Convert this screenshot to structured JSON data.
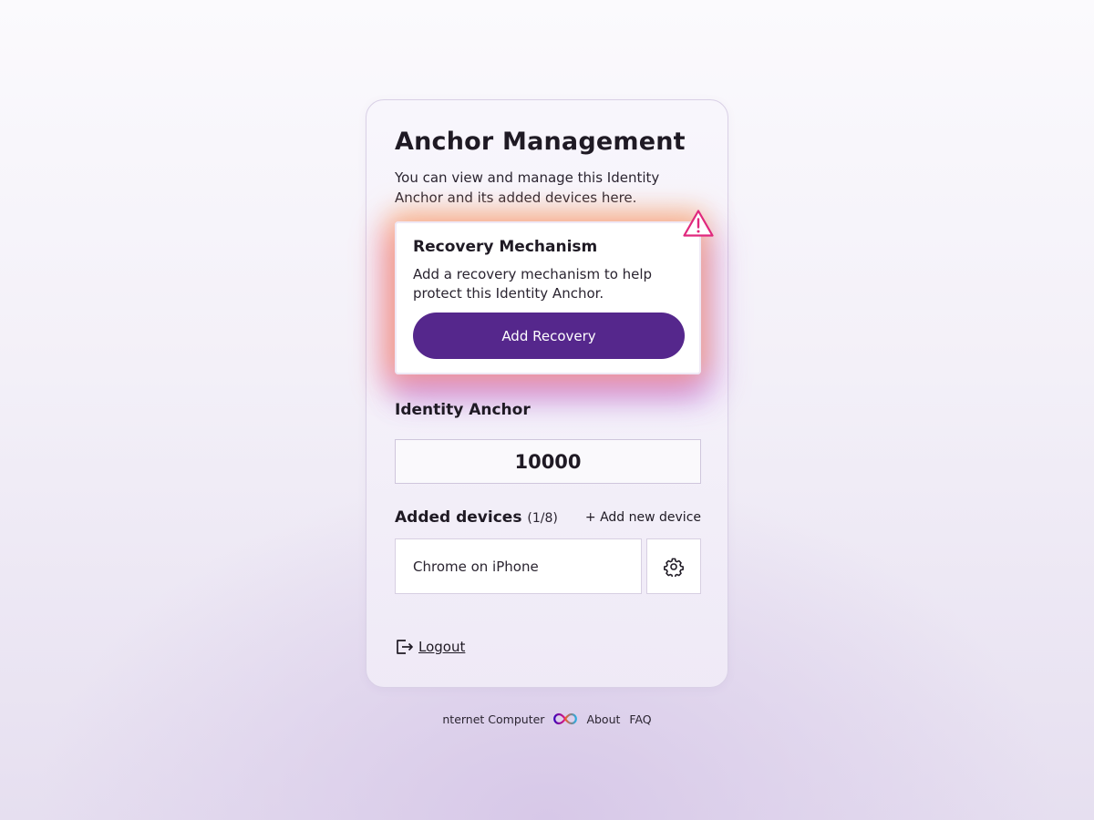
{
  "page": {
    "title": "Anchor Management",
    "subtitle": "You can view and manage this Identity Anchor and its added devices here."
  },
  "recovery": {
    "title": "Recovery Mechanism",
    "text": "Add a recovery mechanism to help protect this Identity Anchor.",
    "button_label": "Add Recovery",
    "icon": "warning-icon"
  },
  "identity_anchor": {
    "label": "Identity Anchor",
    "value": "10000"
  },
  "devices": {
    "label": "Added devices",
    "count": "(1/8)",
    "add_link": "+ Add new device",
    "items": [
      {
        "name": "Chrome on iPhone",
        "icon": "gear-icon"
      }
    ]
  },
  "logout": {
    "label": "Logout",
    "icon": "logout-icon"
  },
  "footer": {
    "brand": "nternet Computer",
    "logo_icon": "infinity-logo-icon",
    "about": "About",
    "faq": "FAQ"
  },
  "colors": {
    "accent": "#55278c",
    "warning": "#e0287d",
    "text": "#1f1a24"
  }
}
